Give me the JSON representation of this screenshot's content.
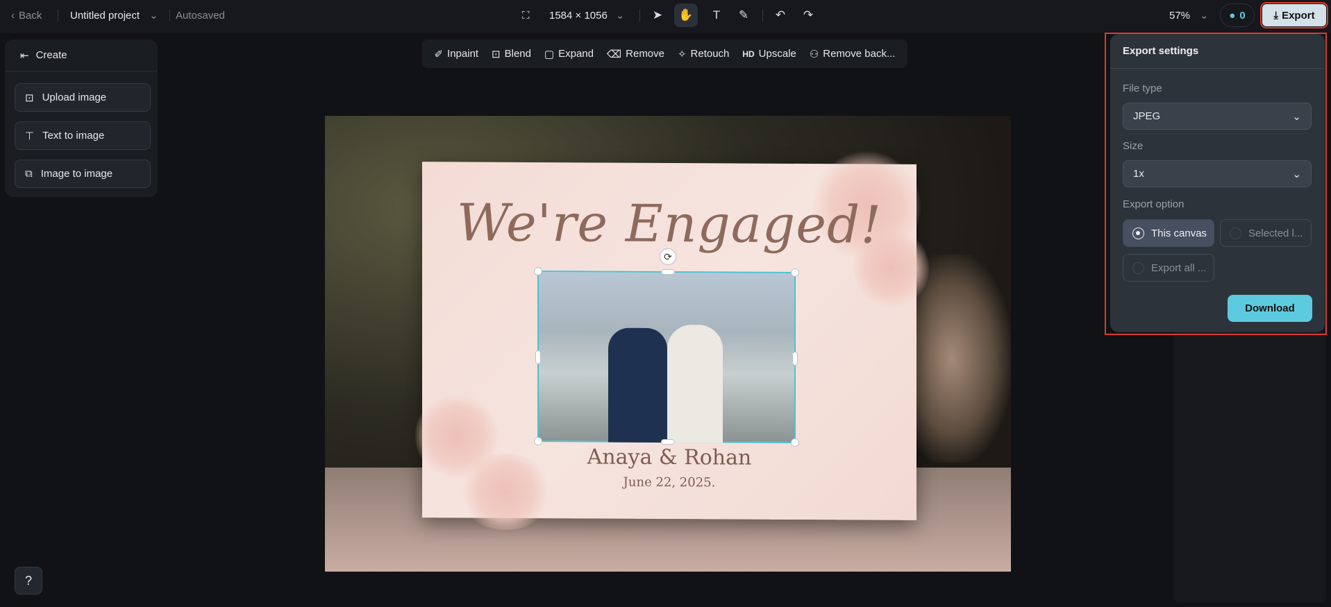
{
  "topbar": {
    "back_label": "Back",
    "project_name": "Untitled project",
    "save_status": "Autosaved",
    "canvas_size": "1584 × 1056",
    "zoom": "57%",
    "credits": "0",
    "export_label": "Export"
  },
  "left_panel": {
    "header": "Create",
    "buttons": [
      "Upload image",
      "Text to image",
      "Image to image"
    ]
  },
  "tools": [
    "Inpaint",
    "Blend",
    "Expand",
    "Remove",
    "Retouch",
    "Upscale",
    "Remove back..."
  ],
  "tools_hd_badge": "HD",
  "canvas": {
    "title": "We're Engaged!",
    "names": "Anaya & Rohan",
    "date": "June 22, 2025."
  },
  "export_panel": {
    "title": "Export settings",
    "file_type_label": "File type",
    "file_type_value": "JPEG",
    "size_label": "Size",
    "size_value": "1x",
    "export_option_label": "Export option",
    "options": [
      "This canvas",
      "Selected l...",
      "Export all ..."
    ],
    "selected_option": "This canvas",
    "download_label": "Download"
  },
  "colors": {
    "accent": "#5ccbe0",
    "highlight": "#e03a25"
  }
}
